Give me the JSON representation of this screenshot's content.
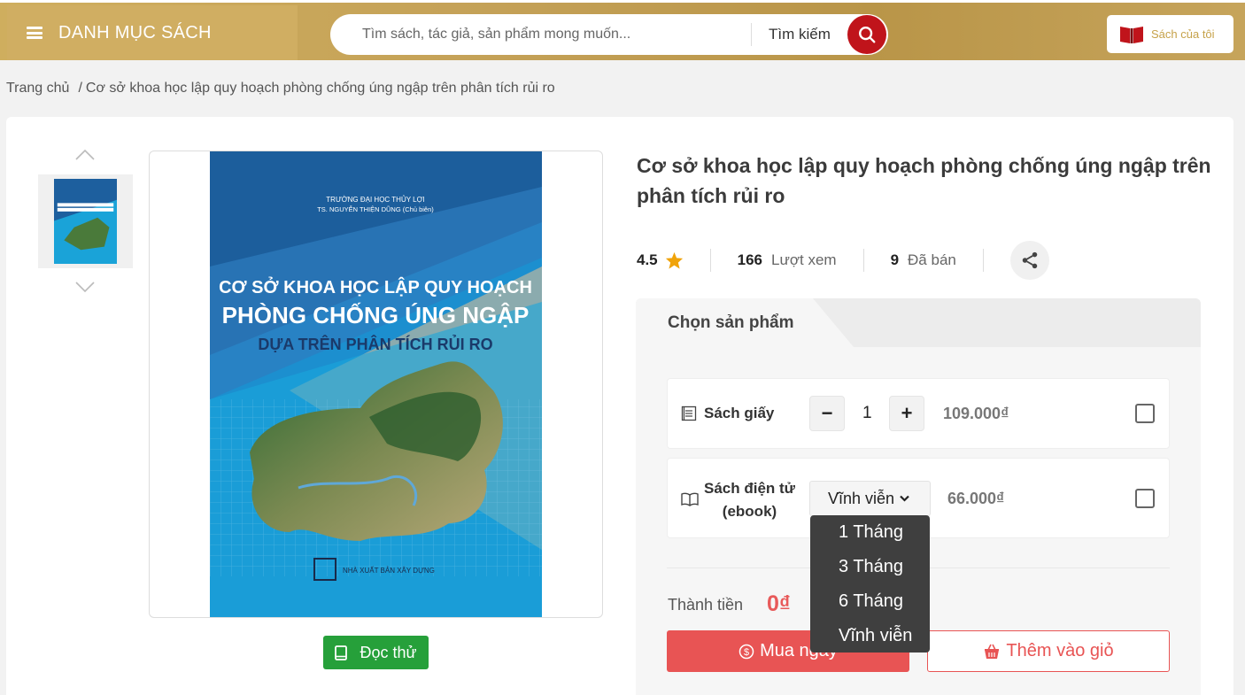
{
  "header": {
    "category_label": "DANH MỤC SÁCH",
    "search_placeholder": "Tìm sách, tác giả, sản phẩm mong muốn...",
    "search_label": "Tìm kiếm",
    "my_books_label": "Sách của tôi"
  },
  "breadcrumb": {
    "home": "Trang chủ",
    "separator": "/",
    "current": "Cơ sở khoa học lập quy hoạch phòng chống úng ngập trên phân tích rủi ro"
  },
  "cover": {
    "institution": "TRƯỜNG ĐẠI HỌC THỦY LỢI",
    "author": "TS. NGUYỄN THIỆN DŨNG (Chủ biên)",
    "title_line1": "CƠ SỞ KHOA HỌC LẬP QUY HOẠCH",
    "title_line2": "PHÒNG CHỐNG ÚNG NGẬP",
    "title_line3": "DỰA TRÊN PHÂN TÍCH RỦI RO",
    "publisher": "NHÀ XUẤT BẢN XÂY DỰNG"
  },
  "read_button_label": "Đọc thử",
  "product": {
    "title": "Cơ sở khoa học lập quy hoạch phòng chống úng ngập trên phân tích rủi ro",
    "rating": "4.5",
    "views_count": "166",
    "views_label": "Lượt xem",
    "sold_count": "9",
    "sold_label": "Đã bán"
  },
  "panel": {
    "tab_label": "Chọn sản phẩm",
    "paper": {
      "label": "Sách giấy",
      "minus": "−",
      "quantity": "1",
      "plus": "+",
      "price": "109.000₫"
    },
    "ebook": {
      "label_line1": "Sách điện tử",
      "label_line2": "(ebook)",
      "selected_option": "Vĩnh viễn",
      "price": "66.000₫"
    },
    "total_label": "Thành tiền",
    "total_value": "0₫",
    "buy_label": "Mua ngay",
    "cart_label": "Thêm vào giỏ"
  },
  "dropdown": {
    "options": [
      "1 Tháng",
      "3 Tháng",
      "6 Tháng",
      "Vĩnh viễn"
    ]
  },
  "colors": {
    "header_gold": "#c4a157",
    "search_red": "#c0141b",
    "read_green": "#26a03a",
    "buy_red": "#e85454",
    "star": "#f0a30a"
  }
}
